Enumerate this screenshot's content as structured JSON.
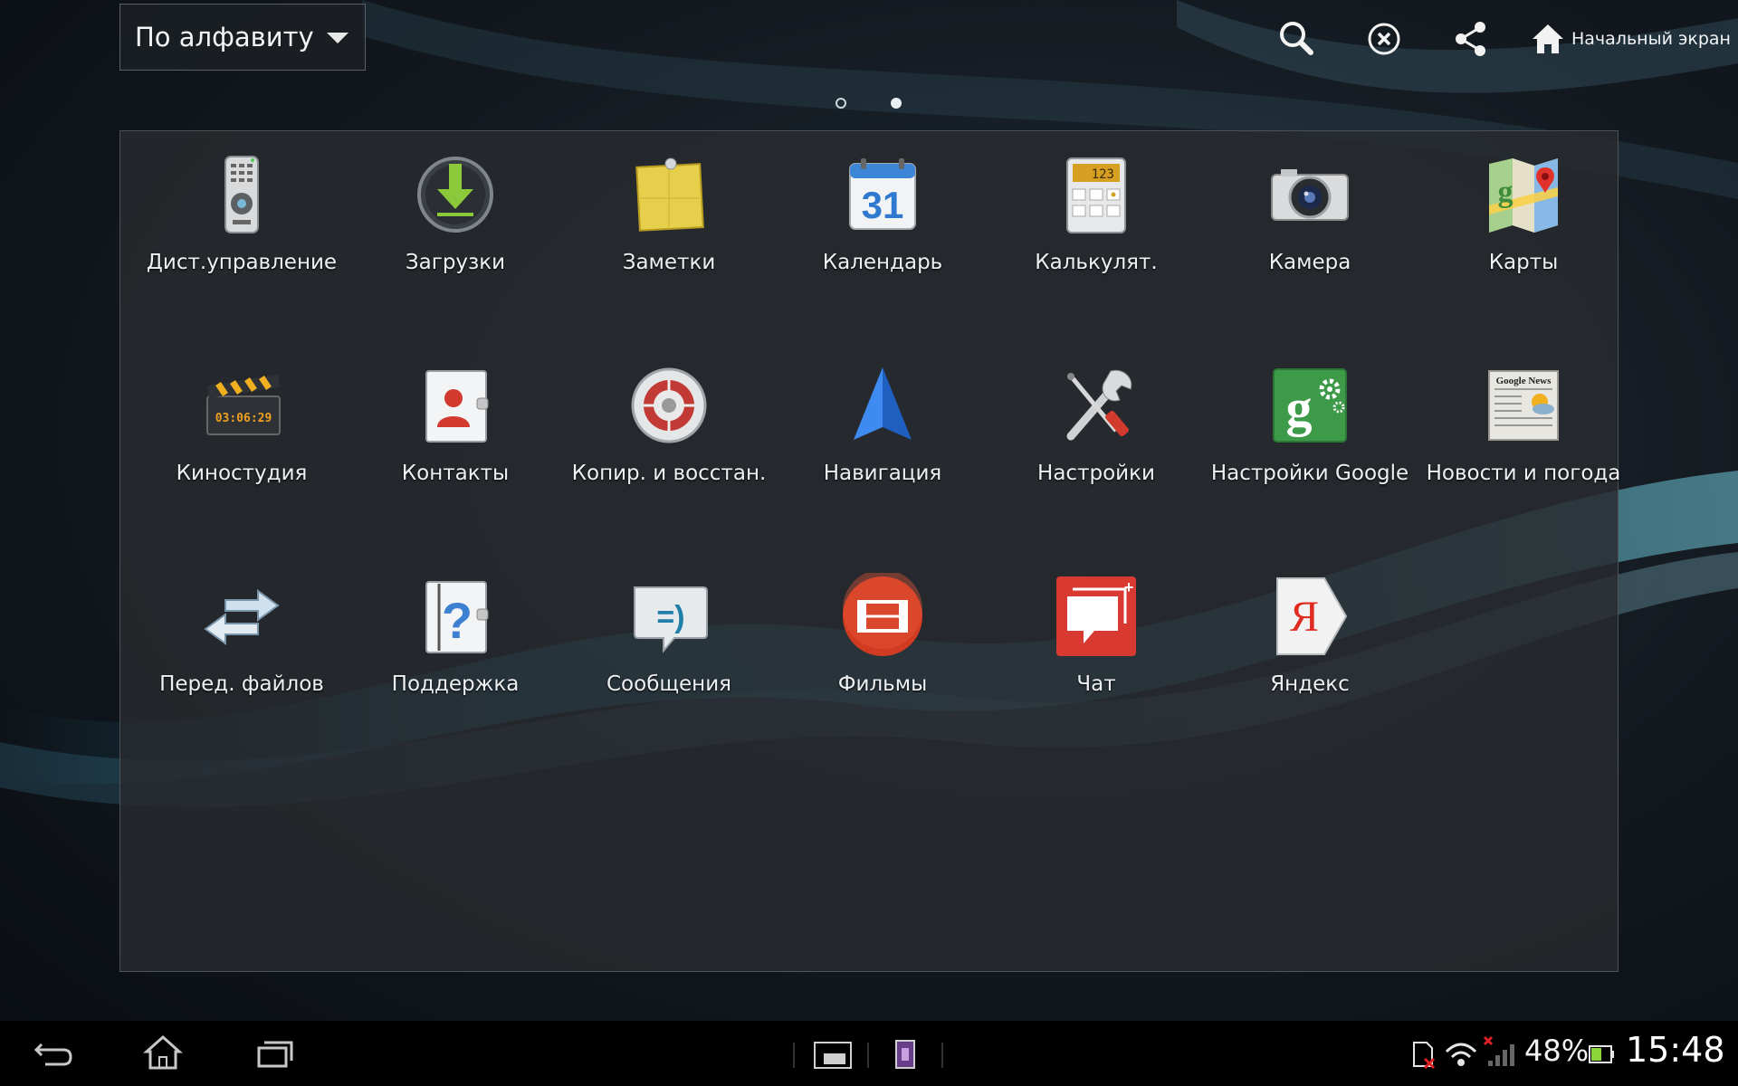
{
  "toolbar": {
    "sort_label": "По алфавиту",
    "home_screen_label": "Начальный экран"
  },
  "pager": {
    "total": 2,
    "current": 2
  },
  "apps": [
    {
      "label": "Дист.управление",
      "icon": "remote-control-icon"
    },
    {
      "label": "Загрузки",
      "icon": "downloads-icon"
    },
    {
      "label": "Заметки",
      "icon": "notes-icon"
    },
    {
      "label": "Календарь",
      "icon": "calendar-icon",
      "icon_text": "31"
    },
    {
      "label": "Калькулят.",
      "icon": "calculator-icon",
      "icon_text": "123"
    },
    {
      "label": "Камера",
      "icon": "camera-icon"
    },
    {
      "label": "Карты",
      "icon": "maps-icon"
    },
    {
      "label": "Киностудия",
      "icon": "movie-studio-icon",
      "icon_text": "03:06:29"
    },
    {
      "label": "Контакты",
      "icon": "contacts-icon"
    },
    {
      "label": "Копир. и восстан.",
      "icon": "backup-restore-icon"
    },
    {
      "label": "Навигация",
      "icon": "navigation-icon"
    },
    {
      "label": "Настройки",
      "icon": "settings-icon"
    },
    {
      "label": "Настройки Google",
      "icon": "google-settings-icon"
    },
    {
      "label": "Новости и погода",
      "icon": "news-weather-icon",
      "icon_text": "Google News"
    },
    {
      "label": "Перед. файлов",
      "icon": "file-transfer-icon"
    },
    {
      "label": "Поддержка",
      "icon": "support-icon"
    },
    {
      "label": "Сообщения",
      "icon": "messages-icon"
    },
    {
      "label": "Фильмы",
      "icon": "movies-icon"
    },
    {
      "label": "Чат",
      "icon": "chat-icon"
    },
    {
      "label": "Яндекс",
      "icon": "yandex-icon",
      "icon_text": "Я"
    }
  ],
  "status": {
    "battery_percent": "48%",
    "time": "15:48"
  }
}
